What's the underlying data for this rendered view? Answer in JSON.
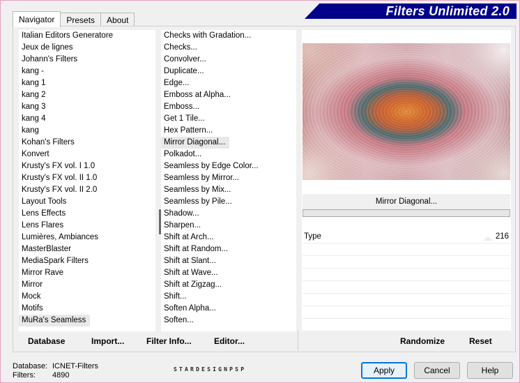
{
  "banner": {
    "title": "Filters Unlimited 2.0"
  },
  "tabs": [
    {
      "label": "Navigator",
      "active": true
    },
    {
      "label": "Presets",
      "active": false
    },
    {
      "label": "About",
      "active": false
    }
  ],
  "categories": [
    "Italian Editors Generatore",
    "Jeux de lignes",
    "Johann's Filters",
    "kang -",
    "kang 1",
    "kang 2",
    "kang 3",
    "kang 4",
    "kang",
    "Kohan's Filters",
    "Konvert",
    "Krusty's FX vol. I 1.0",
    "Krusty's FX vol. II 1.0",
    "Krusty's FX vol. II 2.0",
    "Layout Tools",
    "Lens Effects",
    "Lens Flares",
    "Lumières, Ambiances",
    "MasterBlaster",
    "MediaSpark Filters",
    "Mirror Rave",
    "Mirror",
    "Mock",
    "Motifs",
    "MuRa's Seamless"
  ],
  "selected_category": "MuRa's Seamless",
  "filters": [
    "Checks with Gradation...",
    "Checks...",
    "Convolver...",
    "Duplicate...",
    "Edge...",
    "Emboss at Alpha...",
    "Emboss...",
    "Get 1 Tile...",
    "Hex Pattern...",
    "Mirror Diagonal...",
    "Polkadot...",
    "Seamless by Edge Color...",
    "Seamless by Mirror...",
    "Seamless by Mix...",
    "Seamless by Pile...",
    "Shadow...",
    "Sharpen...",
    "Shift at Arch...",
    "Shift at Random...",
    "Shift at Slant...",
    "Shift at Wave...",
    "Shift at Zigzag...",
    "Shift...",
    "Soften Alpha...",
    "Soften..."
  ],
  "selected_filter": "Mirror Diagonal...",
  "preview": {
    "filter_title": "Mirror Diagonal..."
  },
  "parameters": [
    {
      "label": "Type",
      "value": "216"
    }
  ],
  "panel_buttons": {
    "database": "Database",
    "import": "Import...",
    "filter_info": "Filter Info...",
    "editor": "Editor...",
    "randomize": "Randomize",
    "reset": "Reset"
  },
  "footer": {
    "database_label": "Database:",
    "database_value": "ICNET-Filters",
    "filters_label": "Filters:",
    "filters_value": "4890",
    "signature": "STARDESIGNPSP"
  },
  "dialog_buttons": {
    "apply": "Apply",
    "cancel": "Cancel",
    "help": "Help"
  }
}
